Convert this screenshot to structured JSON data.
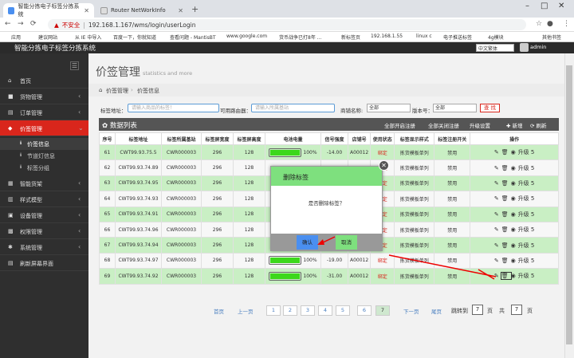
{
  "browser": {
    "tabs": [
      {
        "label": "智能分拣电子标签分拣系统"
      },
      {
        "label": "Router NetWorkInfo"
      }
    ],
    "new_tab": "+",
    "security": "不安全",
    "url": "192.168.1.167/wms/login/userLogin",
    "bookmarks": [
      "应用",
      "建议网站",
      "从 IE 中导入",
      "百度一下，你就知道",
      "查看问题 - MantisBT",
      "www.google.com",
      "货币战争已打8年 ...",
      "新标签页",
      "192.168.1.55",
      "linux c",
      "电子推送标签",
      "4g模块",
      "其他书签"
    ]
  },
  "app": {
    "title": "智能分拣电子标签分拣系统",
    "language": "中文繁体",
    "user": "admin"
  },
  "sidebar": {
    "toggle": "☰",
    "items": [
      {
        "label": "首页"
      },
      {
        "label": "货物管理"
      },
      {
        "label": "订单管理"
      },
      {
        "label": "价签管理"
      },
      {
        "label": "智能货架"
      },
      {
        "label": "样式模型"
      },
      {
        "label": "设备管理"
      },
      {
        "label": "权限管理"
      },
      {
        "label": "系统管理"
      },
      {
        "label": "刷新屏幕界面"
      }
    ],
    "subitems": [
      {
        "label": "价签信息"
      },
      {
        "label": "节道灯信息"
      },
      {
        "label": "标签分组"
      }
    ]
  },
  "page": {
    "title": "价签管理",
    "subtitle": "statistics and more",
    "crumb1": "价签管理",
    "crumb2": "价签信息"
  },
  "filters": {
    "addr_label": "标签地址：",
    "addr_placeholder": "请输入商品的标签！",
    "router_label": "可用路由器：",
    "router_placeholder": "请输入所属基站",
    "vendor_label": "商铺名称:",
    "vendor_value": "全部",
    "version_label": "版本号：",
    "version_value": "全部",
    "search": "查 找"
  },
  "panel": {
    "title": "数据列表",
    "btn_open": "全部开启注册",
    "btn_close": "全部关闭注册",
    "btn_upgrade": "升级设置",
    "btn_add": "新增",
    "btn_refresh": "刷新"
  },
  "table": {
    "headers": [
      "序号",
      "标签地址",
      "标签所属基站",
      "标签屏宽度",
      "标签屏高度",
      "电池电量",
      "信号强度",
      "店铺号",
      "使用状态",
      "标签显示样式",
      "标签注册开关",
      "操作"
    ],
    "rows": [
      {
        "id": "61",
        "addr": "CWT99.93.75.5",
        "station": "CWR000003",
        "w": "296",
        "h": "128",
        "battery": "100%",
        "signal": "-14.00",
        "shop": "A00012",
        "status": "绑定",
        "style": "拣货模板单列",
        "reg": "禁用",
        "upg": "升级 5"
      },
      {
        "id": "62",
        "addr": "CWT99.93.74.89",
        "station": "CWR000003",
        "w": "296",
        "h": "128",
        "battery": "",
        "signal": "",
        "shop": "",
        "status": "绑定",
        "style": "拣货模板单列",
        "reg": "禁用",
        "upg": "升级 5"
      },
      {
        "id": "63",
        "addr": "CWT99.93.74.95",
        "station": "CWR000003",
        "w": "296",
        "h": "128",
        "battery": "",
        "signal": "",
        "shop": "",
        "status": "绑定",
        "style": "拣货模板单列",
        "reg": "禁用",
        "upg": "升级 5"
      },
      {
        "id": "64",
        "addr": "CWT99.93.74.93",
        "station": "CWR000003",
        "w": "296",
        "h": "128",
        "battery": "",
        "signal": "",
        "shop": "",
        "status": "绑定",
        "style": "拣货模板单列",
        "reg": "禁用",
        "upg": "升级 5"
      },
      {
        "id": "65",
        "addr": "CWT99.93.74.91",
        "station": "CWR000003",
        "w": "296",
        "h": "128",
        "battery": "",
        "signal": "",
        "shop": "",
        "status": "绑定",
        "style": "拣货模板单列",
        "reg": "禁用",
        "upg": "升级 5"
      },
      {
        "id": "66",
        "addr": "CWT99.93.74.96",
        "station": "CWR000003",
        "w": "296",
        "h": "128",
        "battery": "",
        "signal": "",
        "shop": "",
        "status": "绑定",
        "style": "拣货模板单列",
        "reg": "禁用",
        "upg": "升级 5"
      },
      {
        "id": "67",
        "addr": "CWT99.93.74.94",
        "station": "CWR000003",
        "w": "296",
        "h": "128",
        "battery": "",
        "signal": "",
        "shop": "",
        "status": "绑定",
        "style": "拣货模板单列",
        "reg": "禁用",
        "upg": "升级 5"
      },
      {
        "id": "68",
        "addr": "CWT99.93.74.97",
        "station": "CWR000003",
        "w": "296",
        "h": "128",
        "battery": "100%",
        "signal": "-19.00",
        "shop": "A00012",
        "status": "绑定",
        "style": "拣货模板单列",
        "reg": "禁用",
        "upg": "升级 5"
      },
      {
        "id": "69",
        "addr": "CWT99.93.74.92",
        "station": "CWR000003",
        "w": "296",
        "h": "128",
        "battery": "100%",
        "signal": "-31.00",
        "shop": "A00012",
        "status": "绑定",
        "style": "拣货模板单列",
        "reg": "禁用",
        "upg": "升级 5"
      }
    ]
  },
  "modal": {
    "title": "删除标签",
    "message": "是否删除标签？",
    "ok": "确认",
    "cancel": "取消",
    "close": "✕"
  },
  "pagination": {
    "first": "首页",
    "prev": "上一页",
    "pages": [
      "1",
      "2",
      "3",
      "4",
      "5",
      "6",
      "7"
    ],
    "next": "下一页",
    "last": "尾页",
    "jump": "跳转到",
    "jump_value": "7",
    "page_unit": "页",
    "total_label": "共",
    "total": "7",
    "total_unit": "页"
  },
  "colors": {
    "accent": "#d9261c",
    "row_green": "#c9efc4",
    "battery": "#3cd81c",
    "modal_header": "#7ee07e"
  }
}
